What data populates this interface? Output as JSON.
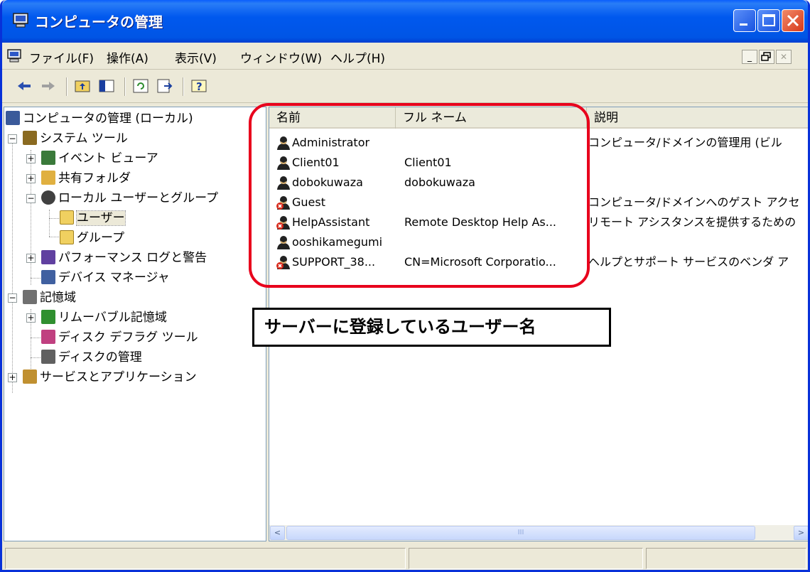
{
  "window": {
    "title": "コンピュータの管理",
    "buttons": {
      "minimize": "_",
      "maximize": "□",
      "close": "✕"
    }
  },
  "menubar": {
    "items": [
      "ファイル(F)",
      "操作(A)",
      "表示(V)",
      "ウィンドウ(W)",
      "ヘルプ(H)"
    ],
    "mdi_buttons": {
      "minimize": "_",
      "restore": "🗗",
      "close": "✕"
    }
  },
  "toolbar": {
    "buttons": [
      "back-icon",
      "forward-icon",
      "up-folder-icon",
      "show-hide-tree-icon",
      "refresh-icon",
      "export-list-icon",
      "help-icon"
    ]
  },
  "tree": {
    "items": [
      {
        "label": "コンピュータの管理 (ローカル)",
        "icon": "computer-icon",
        "expander": "",
        "color": "#3a5a9a"
      },
      {
        "label": "システム ツール",
        "icon": "tools-icon",
        "expander": "−",
        "color": "#8a6a20"
      },
      {
        "label": "イベント ビューア",
        "icon": "event-viewer-icon",
        "expander": "+",
        "color": "#3a7a3a"
      },
      {
        "label": "共有フォルダ",
        "icon": "shared-folder-icon",
        "expander": "+",
        "color": "#e0b040"
      },
      {
        "label": "ローカル ユーザーとグループ",
        "icon": "users-groups-icon",
        "expander": "−",
        "color": "#404040"
      },
      {
        "label": "ユーザー",
        "icon": "folder-icon",
        "expander": "",
        "color": "#f0d060"
      },
      {
        "label": "グループ",
        "icon": "folder-icon",
        "expander": "",
        "color": "#f0d060"
      },
      {
        "label": "パフォーマンス ログと警告",
        "icon": "performance-icon",
        "expander": "+",
        "color": "#6040a0"
      },
      {
        "label": "デバイス マネージャ",
        "icon": "device-manager-icon",
        "expander": "",
        "color": "#4060a0"
      },
      {
        "label": "記憶域",
        "icon": "storage-icon",
        "expander": "−",
        "color": "#707070"
      },
      {
        "label": "リムーバブル記憶域",
        "icon": "removable-storage-icon",
        "expander": "+",
        "color": "#309030"
      },
      {
        "label": "ディスク デフラグ ツール",
        "icon": "defrag-icon",
        "expander": "",
        "color": "#c04080"
      },
      {
        "label": "ディスクの管理",
        "icon": "disk-management-icon",
        "expander": "",
        "color": "#606060"
      },
      {
        "label": "サービスとアプリケーション",
        "icon": "services-icon",
        "expander": "+",
        "color": "#c09030"
      }
    ]
  },
  "list": {
    "columns": [
      "名前",
      "フル ネーム",
      "説明"
    ],
    "rows": [
      {
        "name": "Administrator",
        "full_name": "",
        "description": "コンピュータ/ドメインの管理用 (ビル",
        "disabled": false
      },
      {
        "name": "Client01",
        "full_name": "Client01",
        "description": "",
        "disabled": false
      },
      {
        "name": "dobokuwaza",
        "full_name": "dobokuwaza",
        "description": "",
        "disabled": false
      },
      {
        "name": "Guest",
        "full_name": "",
        "description": "コンピュータ/ドメインへのゲスト アクセ",
        "disabled": true
      },
      {
        "name": "HelpAssistant",
        "full_name": "Remote Desktop Help As...",
        "description": "リモート アシスタンスを提供するための",
        "disabled": true
      },
      {
        "name": "ooshikamegumi",
        "full_name": "",
        "description": "",
        "disabled": false
      },
      {
        "name": "SUPPORT_38...",
        "full_name": "CN=Microsoft Corporatio...",
        "description": "ヘルプとサポート サービスのベンダ ア",
        "disabled": true
      }
    ],
    "scrollbar": {
      "left": "<",
      "right": ">",
      "grip": "III"
    }
  },
  "annotation": {
    "callout": "サーバーに登録しているユーザー名",
    "highlight_color": "#e8001c"
  },
  "colors": {
    "titlebar": "#0055e5",
    "chrome": "#ece9d8"
  }
}
